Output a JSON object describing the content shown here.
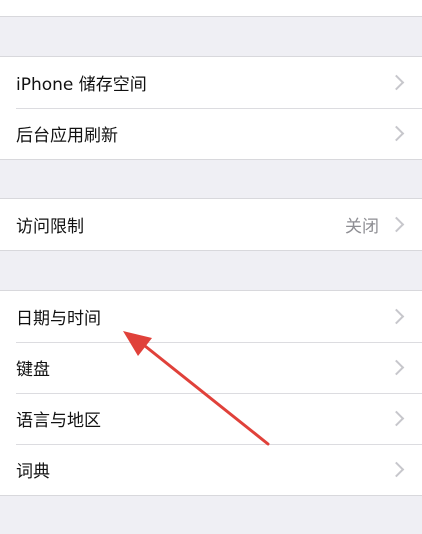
{
  "groups": [
    {
      "rows": [
        {
          "label": ""
        }
      ]
    },
    {
      "rows": [
        {
          "label": "iPhone 储存空间"
        },
        {
          "label": "后台应用刷新"
        }
      ]
    },
    {
      "rows": [
        {
          "label": "访问限制",
          "value": "关闭"
        }
      ]
    },
    {
      "rows": [
        {
          "label": "日期与时间"
        },
        {
          "label": "键盘"
        },
        {
          "label": "语言与地区"
        },
        {
          "label": "词典"
        }
      ]
    }
  ],
  "annotation": {
    "color": "#e0413a",
    "points_to": "日期与时间"
  }
}
